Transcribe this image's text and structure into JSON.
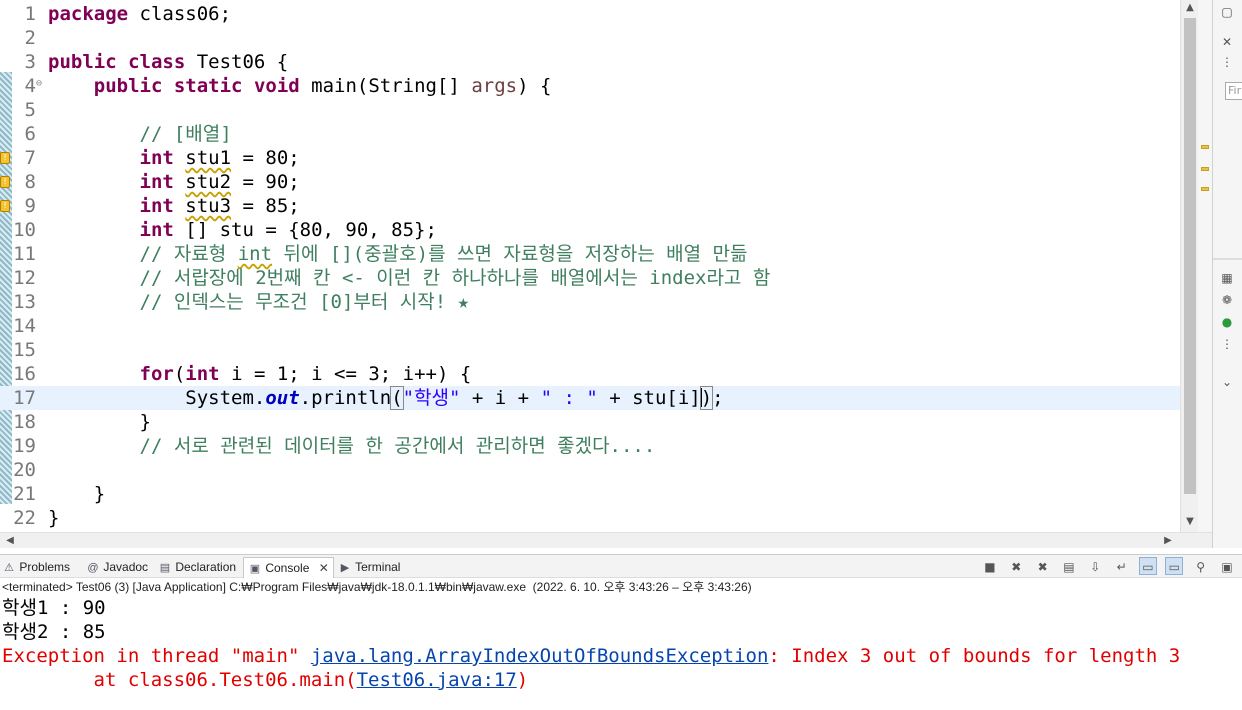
{
  "editor": {
    "lines": [
      {
        "num": "1",
        "segments": [
          [
            "kw",
            "package"
          ],
          [
            "",
            "&nbsp;class06;"
          ]
        ]
      },
      {
        "num": "2",
        "segments": []
      },
      {
        "num": "3",
        "segments": [
          [
            "kw",
            "public"
          ],
          [
            "",
            "&nbsp;"
          ],
          [
            "kw",
            "class"
          ],
          [
            "",
            "&nbsp;Test06 {"
          ]
        ]
      },
      {
        "num": "4",
        "fold": "⊖",
        "segments": [
          [
            "",
            "    "
          ],
          [
            "kw",
            "public"
          ],
          [
            "",
            "&nbsp;"
          ],
          [
            "kw",
            "static"
          ],
          [
            "",
            "&nbsp;"
          ],
          [
            "kw",
            "void"
          ],
          [
            "",
            "&nbsp;main(String[] "
          ],
          [
            "var",
            "args"
          ],
          [
            "",
            ") {"
          ]
        ]
      },
      {
        "num": "5",
        "segments": []
      },
      {
        "num": "6",
        "segments": [
          [
            "",
            "        "
          ],
          [
            "cm",
            "// [배열]"
          ]
        ]
      },
      {
        "num": "7",
        "warn": true,
        "segments": [
          [
            "",
            "        "
          ],
          [
            "kw",
            "int"
          ],
          [
            "",
            "&nbsp;"
          ],
          [
            "wavy",
            "stu1"
          ],
          [
            "",
            "&nbsp;= 80;"
          ]
        ]
      },
      {
        "num": "8",
        "warn": true,
        "segments": [
          [
            "",
            "        "
          ],
          [
            "kw",
            "int"
          ],
          [
            "",
            "&nbsp;"
          ],
          [
            "wavy",
            "stu2"
          ],
          [
            "",
            "&nbsp;= 90;"
          ]
        ]
      },
      {
        "num": "9",
        "warn": true,
        "segments": [
          [
            "",
            "        "
          ],
          [
            "kw",
            "int"
          ],
          [
            "",
            "&nbsp;"
          ],
          [
            "wavy",
            "stu3"
          ],
          [
            "",
            "&nbsp;= 85;"
          ]
        ]
      },
      {
        "num": "10",
        "segments": [
          [
            "",
            "        "
          ],
          [
            "kw",
            "int"
          ],
          [
            "",
            "&nbsp;[] stu = {80, 90, 85};"
          ]
        ]
      },
      {
        "num": "11",
        "segments": [
          [
            "",
            "        "
          ],
          [
            "cm",
            "// 자료형 "
          ],
          [
            "cmwavy",
            "int"
          ],
          [
            "cm",
            " 뒤에 [](중괄호)를 쓰면 자료형을 저장하는 배열 만듦"
          ]
        ]
      },
      {
        "num": "12",
        "segments": [
          [
            "",
            "        "
          ],
          [
            "cm",
            "// 서랍장에 2번째 칸 <- 이런 칸 하나하나를 배열에서는 index라고 함"
          ]
        ]
      },
      {
        "num": "13",
        "segments": [
          [
            "",
            "        "
          ],
          [
            "cm",
            "// 인덱스는 무조건 [0]부터 시작! ★"
          ]
        ]
      },
      {
        "num": "14",
        "segments": []
      },
      {
        "num": "15",
        "segments": []
      },
      {
        "num": "16",
        "segments": [
          [
            "",
            "        "
          ],
          [
            "kw",
            "for"
          ],
          [
            "",
            "("
          ],
          [
            "kw",
            "int"
          ],
          [
            "",
            "&nbsp;i = 1; i <= 3; i++) {"
          ]
        ]
      },
      {
        "num": "17",
        "current": true,
        "segments": [
          [
            "",
            "            System."
          ],
          [
            "fld",
            "out"
          ],
          [
            "",
            ".println"
          ],
          [
            "bracket",
            "("
          ],
          [
            "str",
            "\"학생\""
          ],
          [
            "",
            "&nbsp;+ i + "
          ],
          [
            "str",
            "\" : \""
          ],
          [
            "",
            "&nbsp;+ stu[i]"
          ],
          [
            "caret",
            ""
          ],
          [
            "bracket",
            ")"
          ],
          [
            "",
            ";"
          ]
        ]
      },
      {
        "num": "18",
        "segments": [
          [
            "",
            "        }"
          ]
        ]
      },
      {
        "num": "19",
        "segments": [
          [
            "",
            "        "
          ],
          [
            "cm",
            "// 서로 관련된 데이터를 한 공간에서 관리하면 좋겠다...."
          ]
        ]
      },
      {
        "num": "20",
        "segments": []
      },
      {
        "num": "21",
        "segments": [
          [
            "",
            "    }"
          ]
        ]
      },
      {
        "num": "22",
        "segments": [
          [
            "",
            "}"
          ]
        ]
      }
    ]
  },
  "sidepanel": {
    "find_placeholder": "Fir"
  },
  "tabs": [
    {
      "icon": "⚠",
      "label": "Problems",
      "name": "tab-problems"
    },
    {
      "icon": "@",
      "label": "Javadoc",
      "name": "tab-javadoc"
    },
    {
      "icon": "▤",
      "label": "Declaration",
      "name": "tab-declaration"
    },
    {
      "icon": "▣",
      "label": "Console",
      "name": "tab-console",
      "active": true,
      "close": "✕"
    },
    {
      "icon": "▶",
      "label": "Terminal",
      "name": "tab-terminal"
    }
  ],
  "console": {
    "status": "<terminated> Test06 (3) [Java Application] C:₩Program Files₩java₩jdk-18.0.1.1₩bin₩javaw.exe  (2022. 6. 10. 오후 3:43:26 – 오후 3:43:26)",
    "output_1": "학생1 : 90",
    "output_2": "학생2 : 85",
    "exception_prefix": "Exception in thread \"main\" ",
    "exception_link": "java.lang.ArrayIndexOutOfBoundsException",
    "exception_msg": ": Index 3 out of bounds for length 3",
    "trace_prefix": "        at class06.Test06.main(",
    "trace_link": "Test06.java:17",
    "trace_suffix": ")"
  },
  "colors": {
    "keyword": "#7f0055",
    "comment": "#3f7f5f",
    "string": "#2a00ff",
    "error": "#e00000",
    "current_line": "#e8f2fe"
  }
}
